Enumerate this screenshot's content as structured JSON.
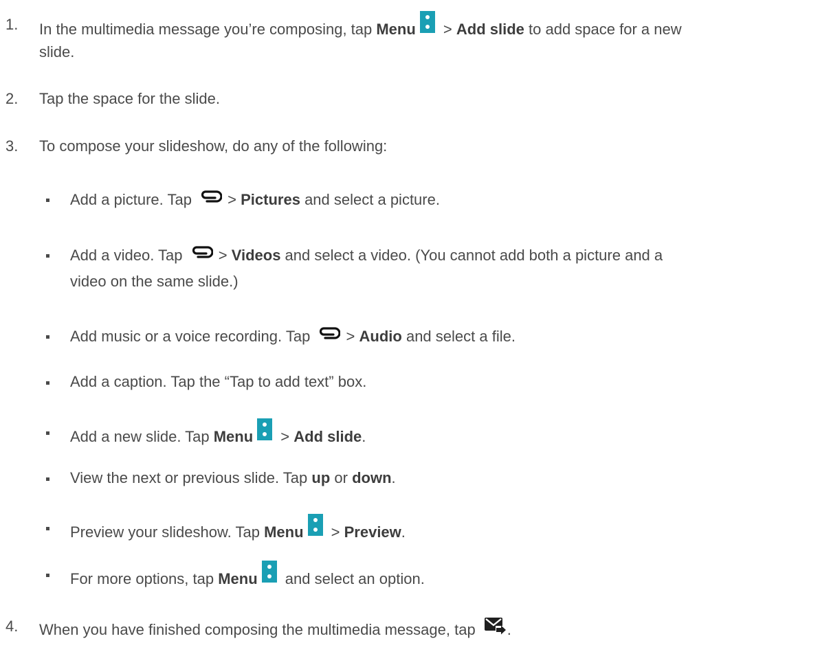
{
  "steps": [
    {
      "num": "1.",
      "a": "In the multimedia message you’re composing, tap ",
      "b1": "Menu",
      "c": " > ",
      "b2": "Add slide",
      "d": " to add space for a new",
      "line2": "slide."
    },
    {
      "num": "2.",
      "text": "Tap the space for the slide."
    },
    {
      "num": "3.",
      "text": "To compose your slideshow, do any of the following:"
    },
    {
      "num": "4.",
      "text": "When you have finished composing the multimedia message, tap ",
      "end": "."
    }
  ],
  "bullets": {
    "picture": {
      "a": "Add a picture. Tap ",
      "gt": " > ",
      "b": "Pictures",
      "c": " and select a picture."
    },
    "video": {
      "a": "Add a video. Tap ",
      "gt": " > ",
      "b": "Videos",
      "c": " and select a video. (You cannot add both a picture and a",
      "line2": "video on the same slide.)"
    },
    "audio": {
      "a": "Add music or a voice recording. Tap ",
      "gt": " > ",
      "b": "Audio",
      "c": " and select a file."
    },
    "caption": {
      "a": "Add a caption. Tap the “Tap to add text” box."
    },
    "new_slide": {
      "a": "Add a new slide. Tap ",
      "b1": "Menu",
      "gt": " > ",
      "b2": "Add slide",
      "end": "."
    },
    "navigate": {
      "a": "View the next or previous slide. Tap ",
      "b1": "up",
      "mid": " or ",
      "b2": "down",
      "end": "."
    },
    "preview": {
      "a": "Preview your slideshow. Tap ",
      "b1": "Menu",
      "gt": " > ",
      "b2": "Preview",
      "end": "."
    },
    "options": {
      "a": "For more options, tap ",
      "b1": "Menu",
      "c": " and select an option."
    }
  },
  "icons": {
    "menu": "menu-icon",
    "attach": "paperclip-icon",
    "send": "send-message-icon",
    "menu_color": "#1a9fb4"
  }
}
